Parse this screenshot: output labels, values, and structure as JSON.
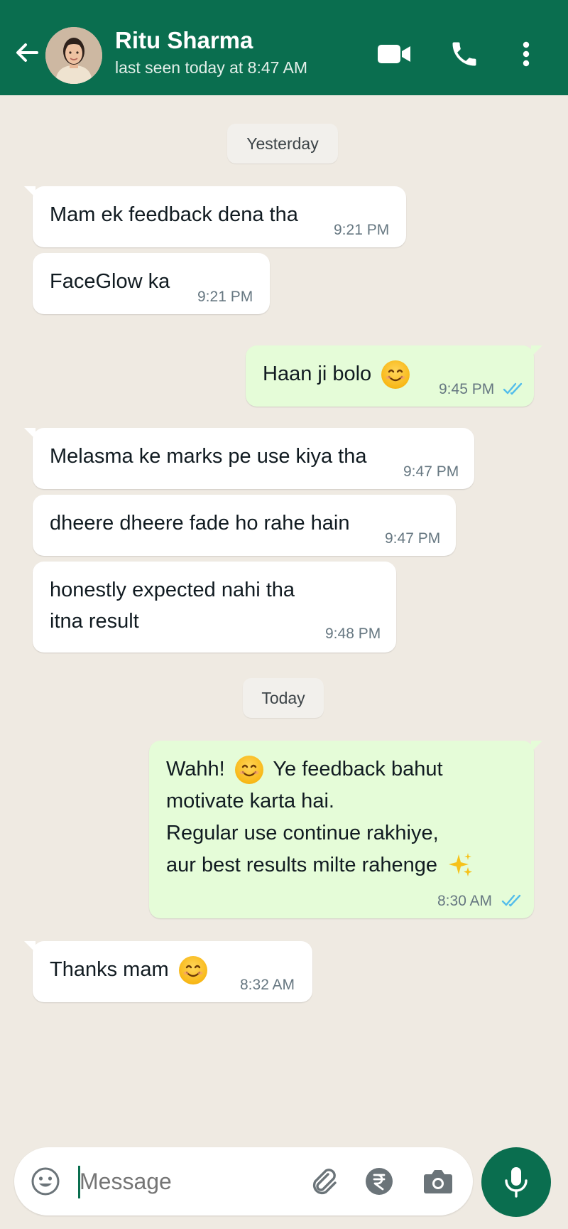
{
  "header": {
    "contact_name": "Ritu Sharma",
    "status": "last seen today at 8:47 AM",
    "icons": [
      "back-arrow-icon",
      "video-call-icon",
      "phone-call-icon",
      "more-options-icon"
    ],
    "colors": {
      "bar": "#0a6e4f"
    }
  },
  "chat": {
    "dates": {
      "yesterday": "Yesterday",
      "today": "Today"
    },
    "messages": [
      {
        "dir": "in",
        "text": "Mam ek feedback dena tha",
        "time": "9:21 PM"
      },
      {
        "dir": "in",
        "text": "FaceGlow ka",
        "time": "9:21 PM"
      },
      {
        "dir": "out",
        "text": "Haan ji bolo",
        "emoji": "smiling-face",
        "time": "9:45 PM",
        "status": "read"
      },
      {
        "dir": "in",
        "text": "Melasma ke marks pe use kiya tha",
        "time": "9:47 PM"
      },
      {
        "dir": "in",
        "text": "dheere dheere fade ho rahe hain",
        "time": "9:47 PM"
      },
      {
        "dir": "in",
        "lines": [
          "honestly expected nahi tha",
          "itna result"
        ],
        "time": "9:48 PM"
      },
      {
        "dir": "out",
        "lines": [
          "Wahh!",
          "Ye feedback bahut",
          "motivate karta hai.",
          "Regular use continue rakhiye,",
          "aur best results milte rahenge"
        ],
        "time": "8:30 AM",
        "status": "read"
      },
      {
        "dir": "in",
        "text": "Thanks mam",
        "emoji": "smiling-face",
        "time": "8:32 AM"
      }
    ],
    "colors": {
      "background": "#efeae2",
      "incoming": "#ffffff",
      "outgoing": "#e5fcd8",
      "read_ticks": "#53bdeb"
    }
  },
  "composer": {
    "placeholder": "Message",
    "icons": [
      "emoji-icon",
      "attach-icon",
      "rupee-payment-icon",
      "camera-icon",
      "mic-icon"
    ]
  }
}
